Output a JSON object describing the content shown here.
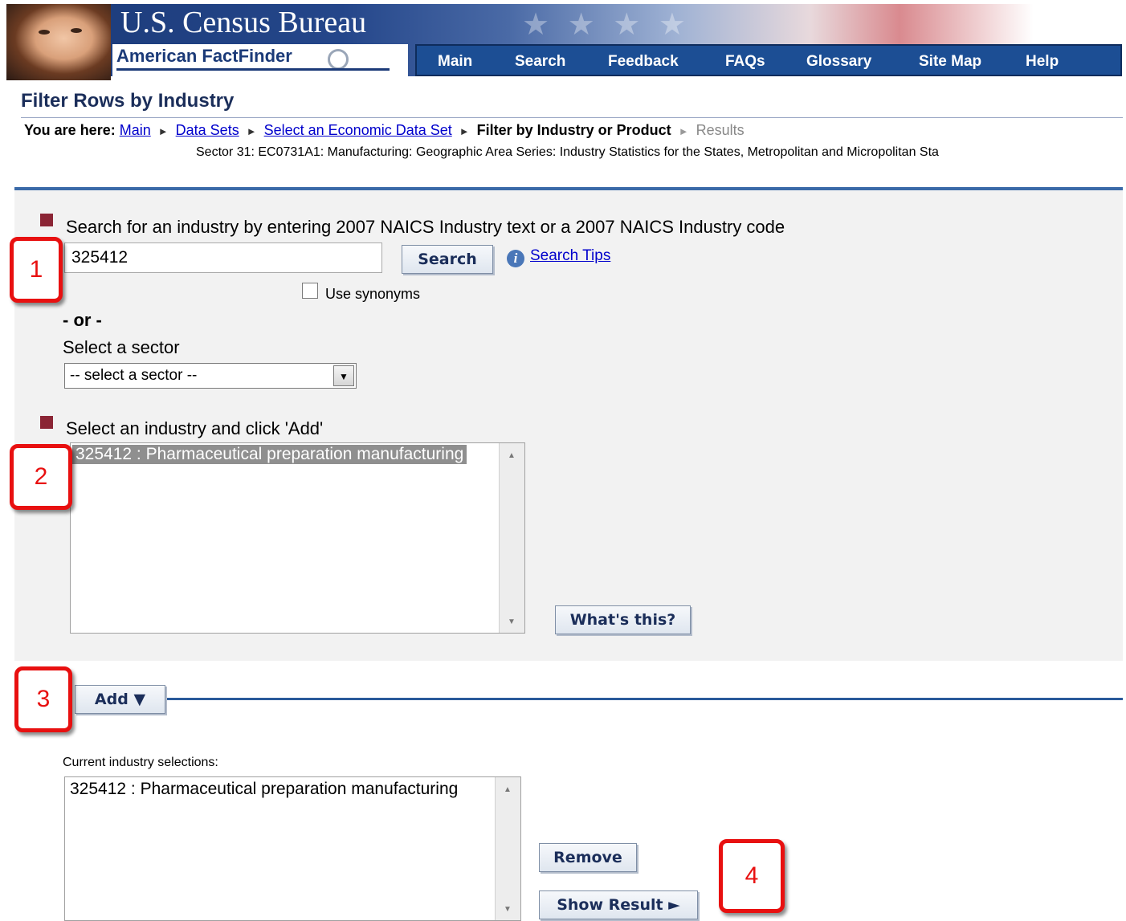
{
  "header": {
    "org_title": "U.S. Census Bureau",
    "product_name": "American FactFinder",
    "nav": [
      "Main",
      "Search",
      "Feedback",
      "FAQs",
      "Glossary",
      "Site Map",
      "Help"
    ]
  },
  "page": {
    "title": "Filter Rows by Industry",
    "breadcrumb": {
      "prefix": "You are here:",
      "links": [
        "Main",
        "Data Sets",
        "Select an Economic Data Set"
      ],
      "current": "Filter by Industry or Product",
      "next": "Results"
    },
    "dataset_description": "Sector 31: EC0731A1: Manufacturing: Geographic Area Series: Industry Statistics for the States, Metropolitan and Micropolitan Sta"
  },
  "search": {
    "prompt": "Search for an industry by entering 2007 NAICS Industry text or a 2007 NAICS Industry code",
    "input_value": "325412",
    "button_label": "Search",
    "tips_link": "Search Tips",
    "synonyms_label": "Use synonyms",
    "synonyms_checked": false
  },
  "sector": {
    "or_label": "- or -",
    "label": "Select a sector",
    "selected": "-- select a sector --"
  },
  "industry_select": {
    "prompt": "Select an industry and click 'Add'",
    "options": [
      "325412 : Pharmaceutical preparation manufacturing"
    ],
    "whats_this_label": "What's this?"
  },
  "add_button_label": "Add ▼",
  "current_selections": {
    "label": "Current industry selections:",
    "items": [
      "325412 : Pharmaceutical preparation manufacturing"
    ],
    "remove_label": "Remove",
    "show_result_label": "Show Result ►"
  },
  "callouts": [
    "1",
    "2",
    "3",
    "4"
  ],
  "colors": {
    "nav_bar": "#1c4e94",
    "bullet": "#8b2535",
    "callout_red": "#e81010",
    "link": "#0000cc",
    "panel_bg": "#f2f2f2"
  }
}
